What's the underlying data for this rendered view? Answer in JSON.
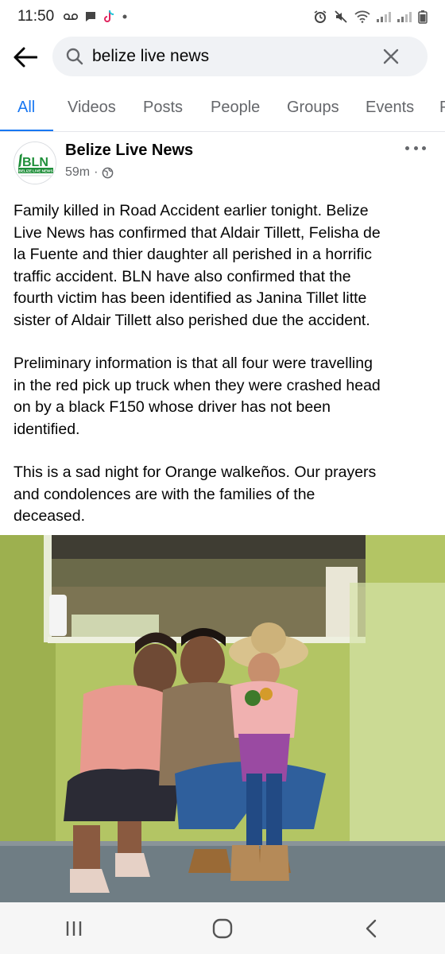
{
  "status_bar": {
    "time": "11:50",
    "left_icons": [
      "voicemail-icon",
      "chat-icon",
      "tiktok-icon",
      "dot-icon"
    ],
    "right_icons": [
      "alarm-icon",
      "mute-icon",
      "wifi-icon",
      "signal-icon",
      "signal-icon"
    ]
  },
  "search": {
    "query": "belize live news"
  },
  "tabs": [
    {
      "label": "All",
      "active": true
    },
    {
      "label": "Videos",
      "active": false
    },
    {
      "label": "Posts",
      "active": false
    },
    {
      "label": "People",
      "active": false
    },
    {
      "label": "Groups",
      "active": false
    },
    {
      "label": "Events",
      "active": false
    },
    {
      "label": "P",
      "active": false
    }
  ],
  "post": {
    "avatar_text": "BLN",
    "avatar_subtext": "BELIZE LIVE NEWS",
    "author": "Belize Live News",
    "time": "59m",
    "separator": "·",
    "privacy_icon": "globe-icon",
    "paragraphs": [
      "Family killed in Road Accident earlier tonight. Belize\nLive News has confirmed that Aldair Tillett, Felisha de\nla Fuente and thier daughter all perished in a horrific\ntraffic accident.  BLN have also confirmed that the\nfourth victim  has been identified as Janina Tillet litte\nsister of Aldair Tillett also perished due the accident.",
      "Preliminary information is that all four were travelling\nin the red pick up truck when they were crashed head\non by a black F150 whose driver has not been\nidentified.",
      "This is a sad night for Orange walkeños. Our prayers\nand condolences are with the families of the\ndeceased."
    ]
  },
  "colors": {
    "accent": "#1877f2",
    "secondary_text": "#65676b",
    "search_bg": "#f0f2f5",
    "logo_green": "#1f8f3a",
    "wall_green": "#a9bf5a"
  }
}
